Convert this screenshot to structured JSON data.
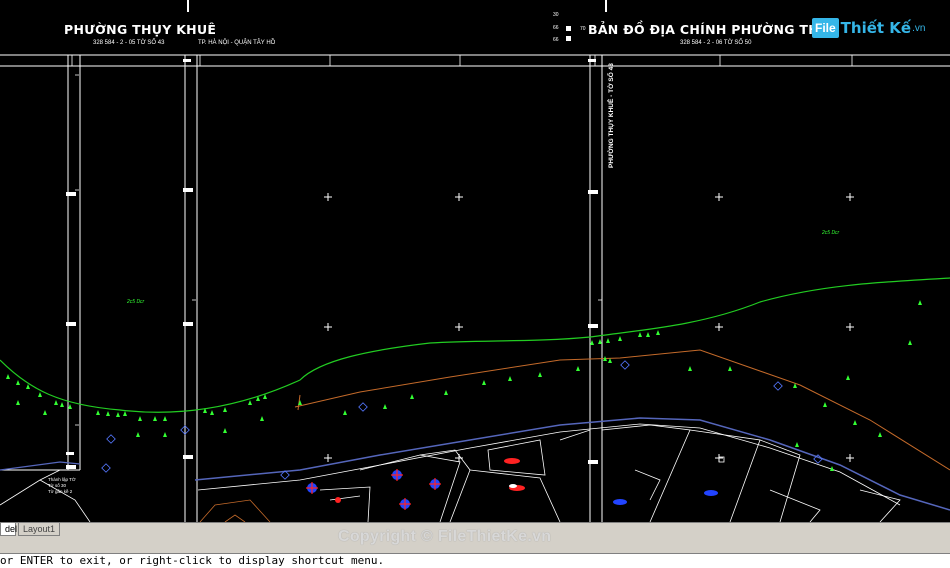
{
  "sheet_left": {
    "title": "PHƯỜNG THỤY KHUÊ",
    "code": "328 584 - 2 - 05 TỜ SỐ 43",
    "city": "TP. HÀ NỘI - QUẬN TÂY HỒ"
  },
  "sheet_right": {
    "title": "BẢN ĐỒ ĐỊA CHÍNH PHƯỜNG THỤY",
    "code": "328 584 - 2 - 06 TỜ SỐ 50"
  },
  "vertical_label": "PHƯỜNG THỤY KHUÊ - TỜ SỐ 43",
  "parcel_labels": [
    "2c5 Dcr",
    "2c5 Dcr"
  ],
  "small_notes": [
    "30",
    "66",
    "70",
    "66"
  ],
  "legend_block": [
    "Thành lập TỜ",
    "Tờ số 30",
    "Tờ gần kề 2"
  ],
  "logo": {
    "box": "File",
    "text": "Thiết Kế",
    "tld": ".vn"
  },
  "tabs": {
    "model": "del",
    "layout1": "Layout1"
  },
  "watermark": "Copyright © FileThietKe.vn",
  "command_line": "or ENTER to exit, or right-click to display shortcut menu.",
  "colors": {
    "background": "#000000",
    "contour": "#22cc22",
    "road": "#c46a2a",
    "road_blue": "#5566bb",
    "vegetation": "#33ff33"
  }
}
